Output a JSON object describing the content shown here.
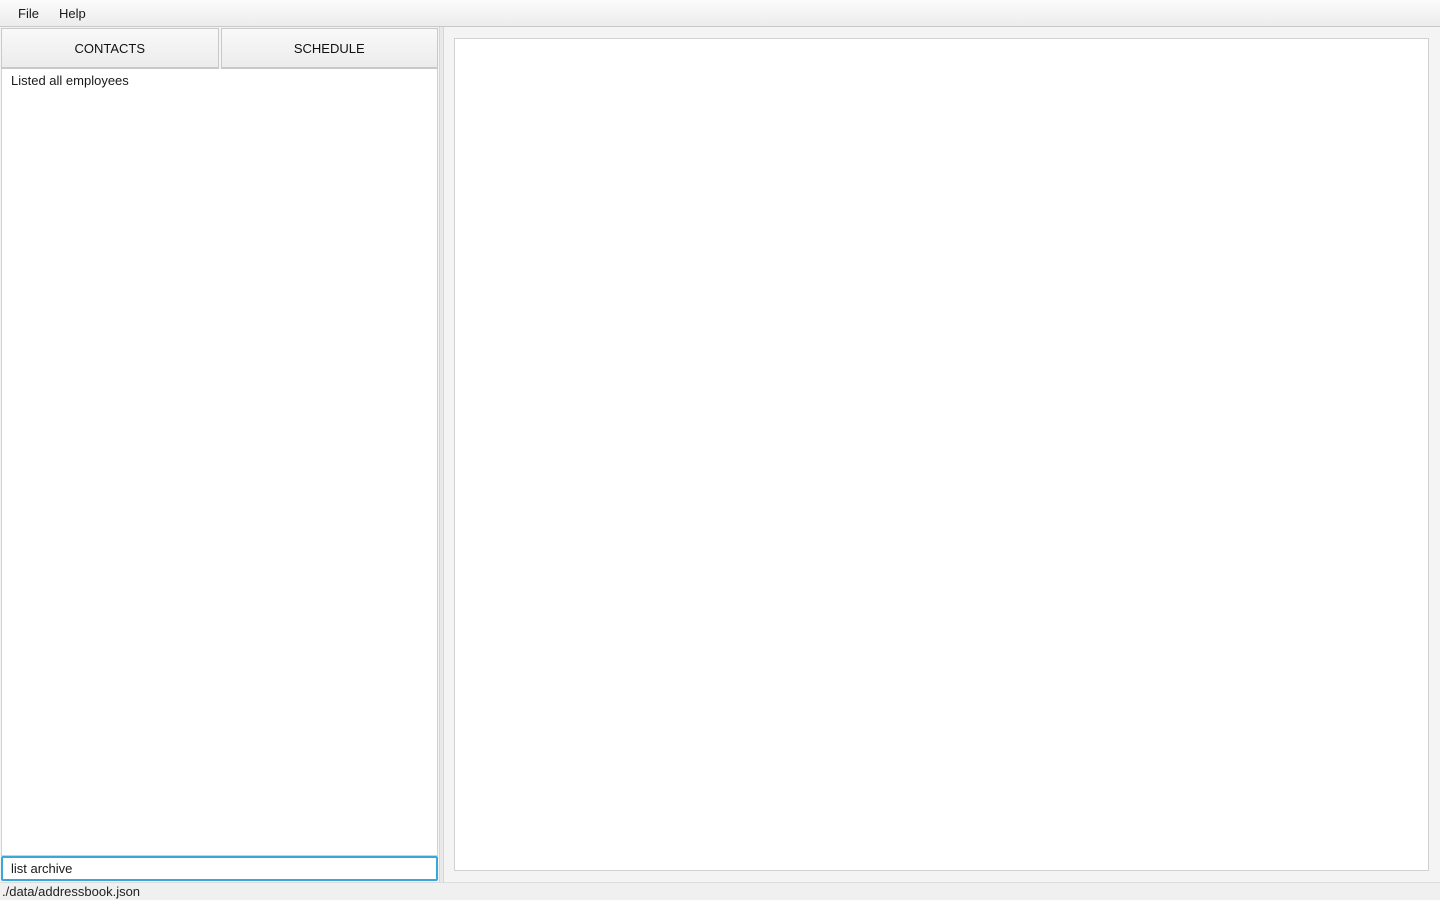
{
  "menu": {
    "items": [
      {
        "label": "File"
      },
      {
        "label": "Help"
      }
    ]
  },
  "tabs": [
    {
      "label": "CONTACTS"
    },
    {
      "label": "SCHEDULE"
    }
  ],
  "result": {
    "message": "Listed all employees"
  },
  "command": {
    "value": "list archive"
  },
  "status": {
    "file_path": "./data/addressbook.json"
  },
  "colors": {
    "focus_accent": "#3aa7d8"
  }
}
